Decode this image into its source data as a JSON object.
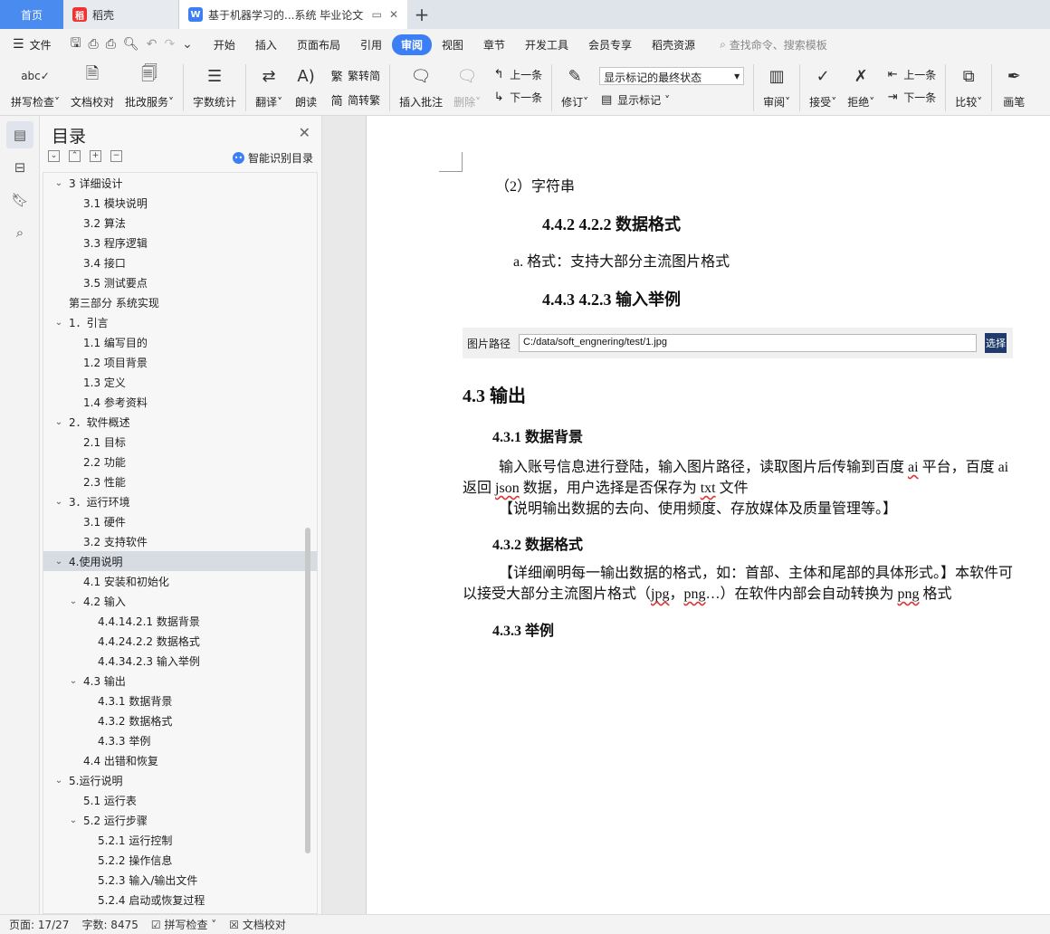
{
  "tabs": {
    "home": "首页",
    "doc1": "稻壳",
    "active": "基于机器学习的...系统 毕业论文"
  },
  "menu": {
    "file": "文件",
    "items": [
      "开始",
      "插入",
      "页面布局",
      "引用",
      "审阅",
      "视图",
      "章节",
      "开发工具",
      "会员专享",
      "稻壳资源"
    ],
    "active_index": 4,
    "search_placeholder": "查找命令、搜索模板"
  },
  "ribbon": {
    "spell_check": "拼写检查",
    "doc_proof": "文档校对",
    "batch_service": "批改服务",
    "word_count": "字数统计",
    "translate": "翻译",
    "read_aloud": "朗读",
    "to_traditional": "繁转简",
    "to_simplified": "简转繁",
    "insert_comment": "插入批注",
    "delete": "删除",
    "prev_comment": "上一条",
    "next_comment": "下一条",
    "revise": "修订",
    "markup_state": "显示标记的最终状态",
    "show_markup": "显示标记",
    "review": "审阅",
    "accept": "接受",
    "reject": "拒绝",
    "prev_change": "上一条",
    "next_change": "下一条",
    "compare": "比较",
    "pen": "画笔"
  },
  "toc": {
    "title": "目录",
    "smart_recognize": "智能识别目录",
    "items": [
      {
        "label": "3 详细设计",
        "level": 0,
        "caret": "v"
      },
      {
        "label": "3.1 模块说明",
        "level": 1
      },
      {
        "label": "3.2 算法",
        "level": 1
      },
      {
        "label": "3.3 程序逻辑",
        "level": 1
      },
      {
        "label": "3.4 接口",
        "level": 1
      },
      {
        "label": "3.5 测试要点",
        "level": 1
      },
      {
        "label": "第三部分  系统实现",
        "level": 0
      },
      {
        "label": "1．引言",
        "level": 0,
        "caret": "v"
      },
      {
        "label": "1.1 编写目的",
        "level": 1
      },
      {
        "label": "1.2 项目背景",
        "level": 1
      },
      {
        "label": "1.3 定义",
        "level": 1
      },
      {
        "label": "1.4 参考资料",
        "level": 1
      },
      {
        "label": "2．软件概述",
        "level": 0,
        "caret": "v"
      },
      {
        "label": "2.1 目标",
        "level": 1
      },
      {
        "label": "2.2 功能",
        "level": 1
      },
      {
        "label": "2.3 性能",
        "level": 1
      },
      {
        "label": "3．运行环境",
        "level": 0,
        "caret": "v"
      },
      {
        "label": "3.1 硬件",
        "level": 1
      },
      {
        "label": "3.2 支持软件",
        "level": 1
      },
      {
        "label": "4.使用说明",
        "level": 0,
        "caret": "v",
        "selected": true
      },
      {
        "label": "4.1 安装和初始化",
        "level": 1
      },
      {
        "label": "4.2 输入",
        "level": 1,
        "caret": "v"
      },
      {
        "label": "4.4.14.2.1 数据背景",
        "level": 2
      },
      {
        "label": "4.4.24.2.2 数据格式",
        "level": 2
      },
      {
        "label": "4.4.34.2.3 输入举例",
        "level": 2
      },
      {
        "label": "4.3 输出",
        "level": 1,
        "caret": "v"
      },
      {
        "label": "4.3.1 数据背景",
        "level": 2
      },
      {
        "label": "4.3.2 数据格式",
        "level": 2
      },
      {
        "label": "4.3.3 举例",
        "level": 2
      },
      {
        "label": "4.4 出错和恢复",
        "level": 1
      },
      {
        "label": "5.运行说明",
        "level": 0,
        "caret": "v"
      },
      {
        "label": "5.1 运行表",
        "level": 1
      },
      {
        "label": "5.2 运行步骤",
        "level": 1,
        "caret": "v"
      },
      {
        "label": "5.2.1 运行控制",
        "level": 2
      },
      {
        "label": "5.2.2 操作信息",
        "level": 2
      },
      {
        "label": "5.2.3 输入/输出文件",
        "level": 2
      },
      {
        "label": "5.2.4 启动或恢复过程",
        "level": 2
      }
    ]
  },
  "document": {
    "string_item": "（2）字符串",
    "h442": "4.4.2  4.2.2 数据格式",
    "format_item": "a.   格式：支持大部分主流图片格式",
    "h443": "4.4.3  4.2.3 输入举例",
    "path_label": "图片路径",
    "path_value": "C:/data/soft_engnering/test/1.jpg",
    "choose_button": "选择",
    "h43": "4.3 输出",
    "h431": "4.3.1 数据背景",
    "p1_line1_a": "输入账号信息进行登陆，输入图片路径，读取图片后传输到百度 ",
    "p1_ai": "ai",
    "p1_line1_b": " 平台，百度 ai",
    "p1_line2_a": "返回 ",
    "p1_json": "json",
    "p1_line2_b": " 数据，用户选择是否保存为 ",
    "p1_txt": "txt",
    "p1_line2_c": " 文件",
    "p1_line3": "【说明输出数据的去向、使用频度、存放媒体及质量管理等。】",
    "h432": "4.3.2 数据格式",
    "p2_line1": "【详细阐明每一输出数据的格式，如：首部、主体和尾部的具体形式。】本软件可",
    "p2_line2_a": "以接受大部分主流图片格式（",
    "p2_jpg": "jpg",
    "p2_sep": "，",
    "p2_png": "png",
    "p2_line2_b": "…）在软件内部会自动转换为 ",
    "p2_png2": "png",
    "p2_line2_c": " 格式",
    "h433": "4.3.3 举例"
  },
  "status": {
    "page": "页面: 17/27",
    "words": "字数: 8475",
    "spell": "拼写检查",
    "proof": "文档校对"
  },
  "colors": {
    "accent": "#3c7ff5",
    "home_tab": "#4a8bf0",
    "choose_btn": "#1f3a6b"
  }
}
